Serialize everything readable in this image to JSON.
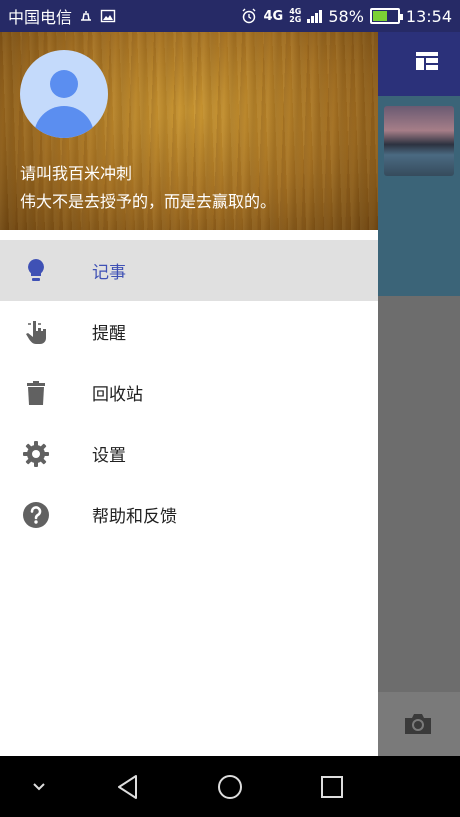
{
  "status_bar": {
    "carrier": "中国电信",
    "network_type": "4G",
    "network_sub_top": "4G",
    "network_sub_bottom": "2G",
    "battery_percent": "58%",
    "time": "13:54"
  },
  "drawer": {
    "user_name": "请叫我百米冲刺",
    "user_motto": "伟大不是去授予的，而是去赢取的。",
    "menu": [
      {
        "label": "记事",
        "icon": "lightbulb-icon",
        "active": true
      },
      {
        "label": "提醒",
        "icon": "touch-hand-icon",
        "active": false
      },
      {
        "label": "回收站",
        "icon": "trash-icon",
        "active": false
      },
      {
        "label": "设置",
        "icon": "gear-icon",
        "active": false
      },
      {
        "label": "帮助和反馈",
        "icon": "help-icon",
        "active": false
      }
    ]
  },
  "colors": {
    "accent": "#3f51b5",
    "toolbar": "#2b317a",
    "status_bar": "#262a66"
  },
  "nav_bar": {
    "icons": [
      "chevron-down-icon",
      "back-icon",
      "home-icon",
      "recents-icon"
    ]
  }
}
